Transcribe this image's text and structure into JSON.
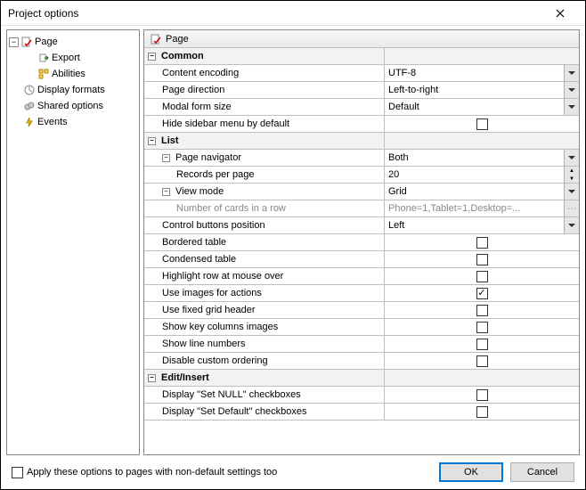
{
  "window": {
    "title": "Project options"
  },
  "sidebar": {
    "items": [
      {
        "label": "Page",
        "icon": "page-check"
      },
      {
        "label": "Export",
        "icon": "export"
      },
      {
        "label": "Abilities",
        "icon": "abilities"
      },
      {
        "label": "Display formats",
        "icon": "display-formats"
      },
      {
        "label": "Shared options",
        "icon": "shared-options"
      },
      {
        "label": "Events",
        "icon": "events"
      }
    ]
  },
  "content": {
    "header": "Page",
    "groups": {
      "common": {
        "title": "Common",
        "rows": {
          "encoding": {
            "label": "Content encoding",
            "value": "UTF-8"
          },
          "direction": {
            "label": "Page direction",
            "value": "Left-to-right"
          },
          "modal": {
            "label": "Modal form size",
            "value": "Default"
          },
          "hideSidebar": {
            "label": "Hide sidebar menu by default",
            "checked": false
          }
        }
      },
      "list": {
        "title": "List",
        "rows": {
          "navigator": {
            "label": "Page navigator",
            "value": "Both"
          },
          "records": {
            "label": "Records per page",
            "value": "20"
          },
          "viewMode": {
            "label": "View mode",
            "value": "Grid"
          },
          "cardsRow": {
            "label": "Number of cards in a row",
            "value": "Phone=1,Tablet=1,Desktop=..."
          },
          "controlPos": {
            "label": "Control buttons position",
            "value": "Left"
          },
          "bordered": {
            "label": "Bordered table",
            "checked": false
          },
          "condensed": {
            "label": "Condensed table",
            "checked": false
          },
          "highlight": {
            "label": "Highlight row at mouse over",
            "checked": false
          },
          "images": {
            "label": "Use images for actions",
            "checked": true
          },
          "fixedHeader": {
            "label": "Use fixed grid header",
            "checked": false
          },
          "keyCols": {
            "label": "Show key columns images",
            "checked": false
          },
          "lineNums": {
            "label": "Show line numbers",
            "checked": false
          },
          "disableOrder": {
            "label": "Disable custom ordering",
            "checked": false
          }
        }
      },
      "edit": {
        "title": "Edit/Insert",
        "rows": {
          "setNull": {
            "label": "Display \"Set NULL\" checkboxes",
            "checked": false
          },
          "setDefault": {
            "label": "Display \"Set Default\" checkboxes",
            "checked": false
          }
        }
      }
    }
  },
  "footer": {
    "applyLabel": "Apply these options to pages with non-default settings too",
    "ok": "OK",
    "cancel": "Cancel"
  }
}
